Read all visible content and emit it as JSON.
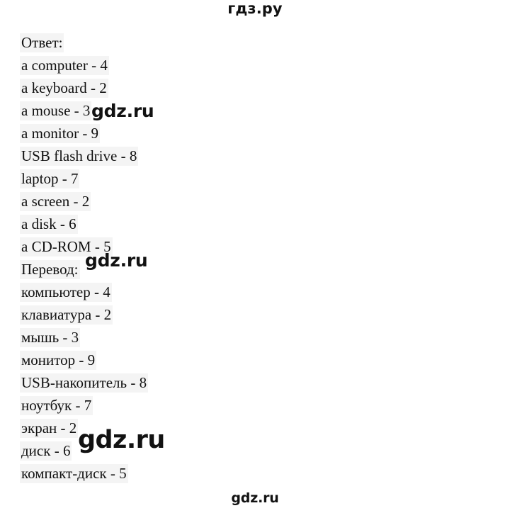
{
  "watermarks": {
    "top": "гдз.ру",
    "bottom": "gdz.ru",
    "overlay_1": "gdz.ru",
    "overlay_2": "gdz.ru",
    "overlay_3": "gdz.ru"
  },
  "answer": {
    "heading": "Ответ:",
    "lines": [
      "a computer - 4",
      "a keyboard - 2",
      "a mouse - 3",
      "a monitor - 9",
      "USB flash drive - 8",
      "laptop - 7",
      "a screen - 2",
      "a disk - 6",
      "a CD-ROM - 5"
    ]
  },
  "translation": {
    "heading": "Перевод:",
    "lines": [
      "компьютер - 4",
      "клавиатура - 2",
      "мышь - 3",
      "монитор - 9",
      "USB-накопитель - 8",
      "ноутбук - 7",
      "экран - 2",
      "диск - 6",
      "компакт-диск - 5"
    ]
  },
  "colors": {
    "text": "#111111",
    "highlight": "#f4f4f4",
    "background": "#ffffff",
    "watermark": "#121212"
  }
}
